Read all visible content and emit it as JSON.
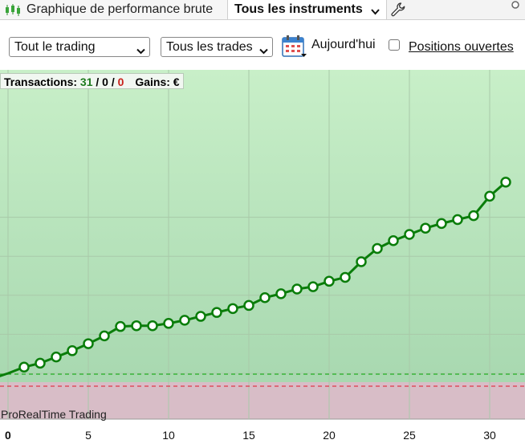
{
  "tabs": {
    "raw_performance_label": "Graphique de performance brute",
    "instruments_label": "Tous les instruments"
  },
  "toolbar": {
    "trading_filter": "Tout le trading",
    "trades_filter": "Tous les trades",
    "date_label": "Aujourd'hui",
    "open_positions_label": "Positions ouvertes",
    "open_positions_checked": false
  },
  "summary": {
    "transactions_label": "Transactions:",
    "count_total": "31",
    "separator1": "/",
    "count_mid": "0",
    "separator2": "/",
    "count_losses": "0",
    "gains_label": "Gains: €"
  },
  "watermark": "ProRealTime Trading",
  "colors": {
    "line": "#0a7d0a",
    "area_top": "#c8efc8",
    "area_bottom": "#a8d8b0",
    "loss_zone": "#d8bdc7",
    "green_dash": "#22b022",
    "red_dash": "#e0394a"
  },
  "chart_data": {
    "type": "line",
    "xlabel": "",
    "ylabel": "",
    "x_ticks": [
      0,
      5,
      10,
      15,
      20,
      25,
      30
    ],
    "xlim": [
      0,
      32
    ],
    "ylim": [
      -3,
      24
    ],
    "grid": true,
    "series": [
      {
        "x": [
          0,
          1,
          2,
          3,
          4,
          5,
          6,
          7,
          8,
          9,
          10,
          11,
          12,
          13,
          14,
          15,
          16,
          17,
          18,
          19,
          20,
          21,
          22,
          23,
          24,
          25,
          26,
          27,
          28,
          29,
          30,
          31
        ],
        "values": [
          0,
          0.8,
          1.3,
          2.1,
          2.9,
          3.8,
          4.8,
          6.0,
          6.1,
          6.1,
          6.4,
          6.8,
          7.3,
          7.8,
          8.3,
          8.7,
          9.7,
          10.2,
          10.8,
          11.1,
          11.8,
          12.3,
          14.3,
          16.0,
          17.0,
          17.8,
          18.6,
          19.2,
          19.7,
          20.2,
          22.7,
          24.5
        ]
      }
    ]
  }
}
